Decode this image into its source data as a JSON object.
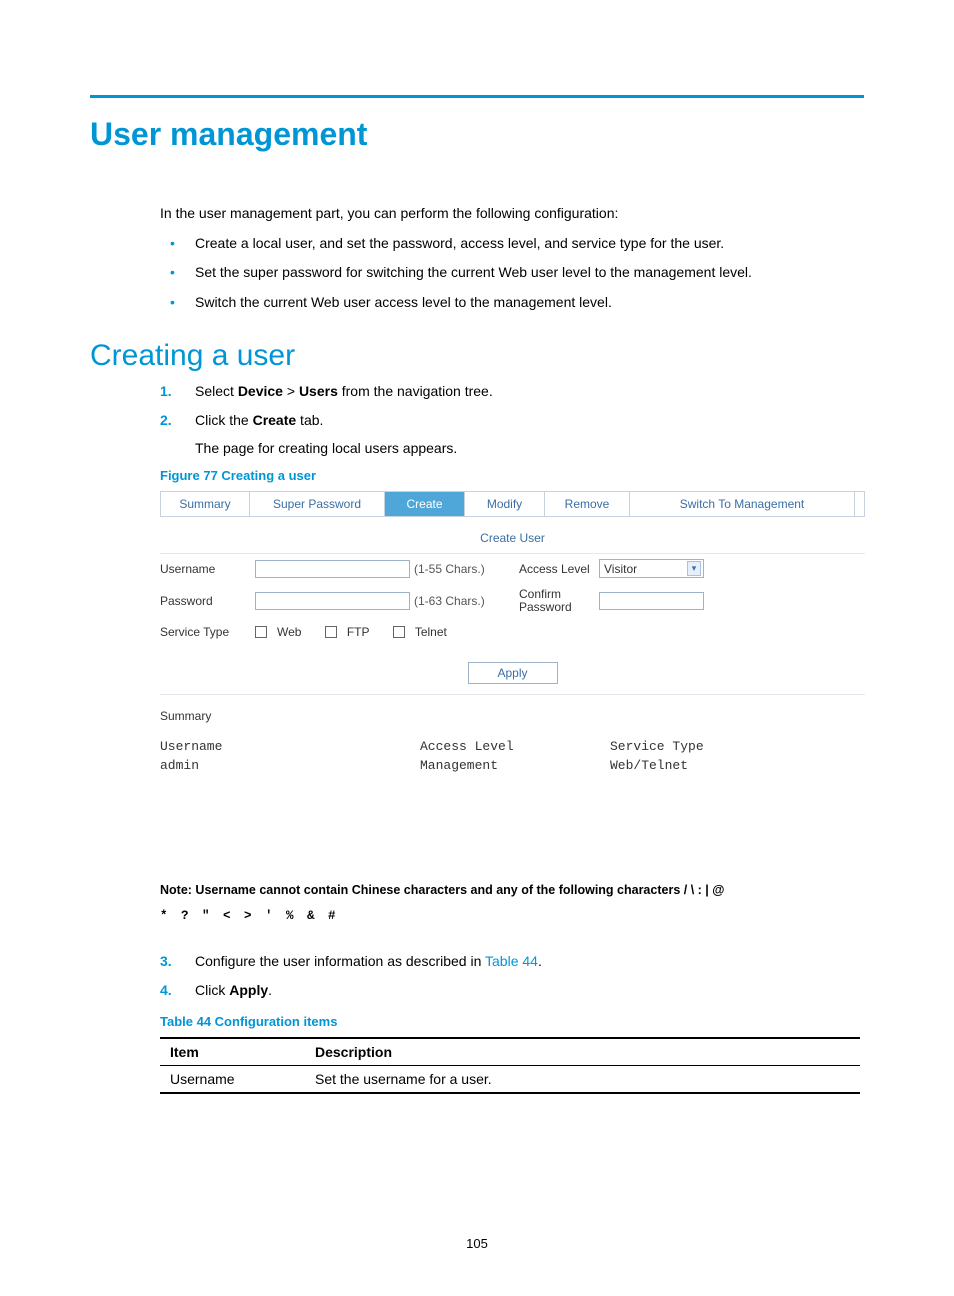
{
  "heading_main": "User management",
  "intro": {
    "lead": "In the user management part, you can perform the following configuration:",
    "bullets": [
      "Create a local user, and set the password, access level, and service type for the user.",
      "Set the super password for switching the current Web user level to the management level.",
      "Switch the current Web user access level to the management level."
    ]
  },
  "section2": {
    "title": "Creating a user",
    "step1_pre": "Select ",
    "step1_device": "Device",
    "step1_gt": " > ",
    "step1_users": "Users",
    "step1_post": " from the navigation tree.",
    "step2_pre": "Click the ",
    "step2_create": "Create",
    "step2_post": " tab.",
    "step2_sub": "The page for creating local users appears.",
    "step3_pre": "Configure the user information as described in ",
    "step3_link": "Table 44",
    "step3_post": ".",
    "step4_pre": "Click ",
    "step4_apply": "Apply",
    "step4_post": "."
  },
  "figure": {
    "caption": "Figure 77 Creating a user",
    "tabs": [
      "Summary",
      "Super Password",
      "Create",
      "Modify",
      "Remove",
      "Switch To Management"
    ],
    "active_tab_index": 2,
    "panel_title": "Create User",
    "username_label": "Username",
    "username_hint": "(1-55 Chars.)",
    "access_level_label": "Access Level",
    "access_level_value": "Visitor",
    "password_label": "Password",
    "password_hint": "(1-63 Chars.)",
    "confirm_label_l1": "Confirm",
    "confirm_label_l2": "Password",
    "service_type_label": "Service Type",
    "service_web": "Web",
    "service_ftp": "FTP",
    "service_telnet": "Telnet",
    "apply_btn": "Apply",
    "summary_header": "Summary",
    "summary_cols": [
      "Username",
      "Access Level",
      "Service Type"
    ],
    "summary_row": [
      "admin",
      "Management",
      "Web/Telnet"
    ],
    "note_lead": "Note: Username cannot contain Chinese characters and any of the following characters / \\ : | @",
    "note_chars": "* ? \" < > ' % & #"
  },
  "table44": {
    "caption": "Table 44 Configuration items",
    "head_item": "Item",
    "head_desc": "Description",
    "row1_item": "Username",
    "row1_desc": "Set the username for a user."
  },
  "page_number": "105"
}
